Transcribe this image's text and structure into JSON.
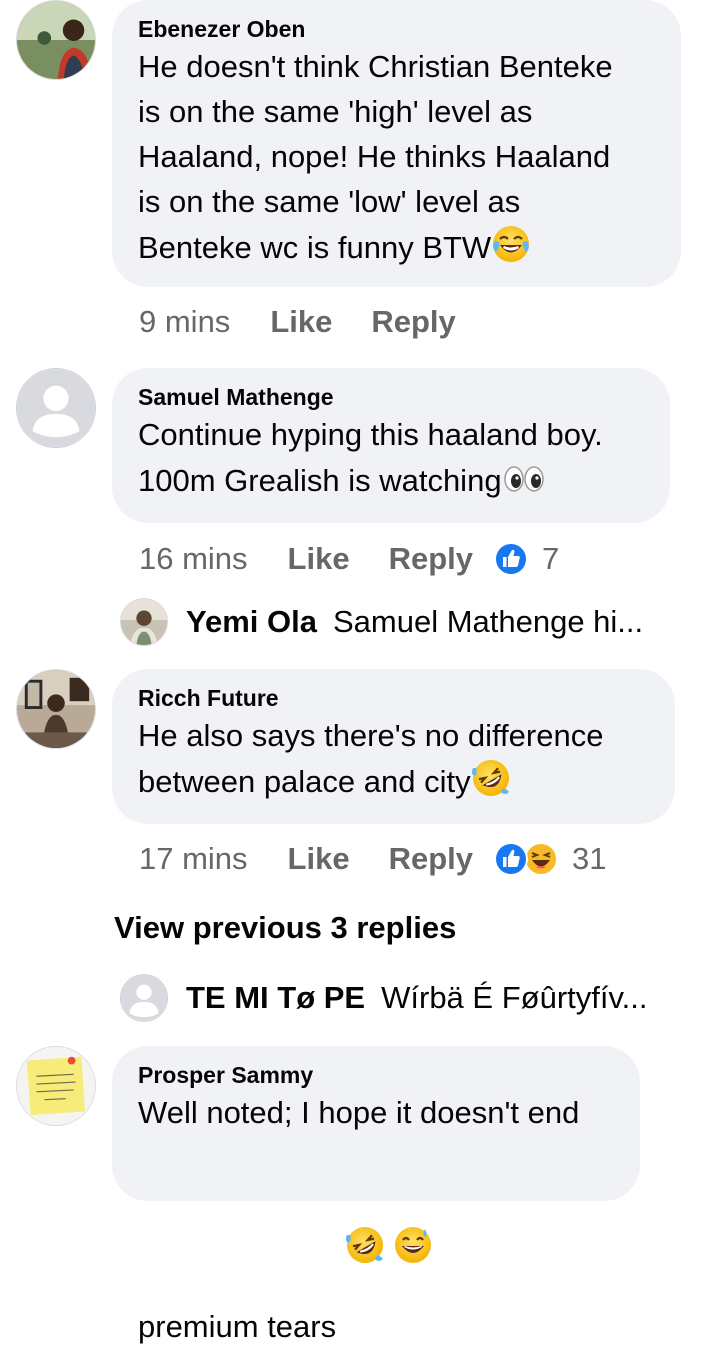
{
  "comments": [
    {
      "author": "Ebenezer Oben",
      "lines": [
        "He doesn't think Christian Benteke",
        "is on the same 'high' level as",
        "Haaland, nope! He thinks Haaland",
        "is on the same 'low' level as"
      ],
      "last_line": "Benteke wc is funny BTW",
      "emoji": "face-with-tears-of-joy-icon",
      "time": "9 mins",
      "like": "Like",
      "reply": "Reply"
    },
    {
      "author": "Samuel Mathenge",
      "lines": [
        "Continue hyping this haaland boy."
      ],
      "last_line": "100m Grealish is watching",
      "emoji": "eyes-icon",
      "time": "16 mins",
      "like": "Like",
      "reply": "Reply",
      "reaction_count": "7",
      "reply_preview": {
        "name": "Yemi Ola",
        "snippet": "Samuel Mathenge hi..."
      }
    },
    {
      "author": "Ricch Future",
      "lines": [
        "He also says there's no difference"
      ],
      "last_line": "between palace and city",
      "emoji": "rolling-on-floor-laughing-icon",
      "time": "17 mins",
      "like": "Like",
      "reply": "Reply",
      "reaction_count": "31",
      "view_previous": "View previous 3 replies",
      "reply_preview": {
        "name": "TE MI Tø PE",
        "snippet": "Wírbä É Føûrtyfív..."
      }
    },
    {
      "author": "Prosper Sammy",
      "lines": [
        "Well noted; I hope it doesn't end"
      ],
      "last_line": "premium tears ",
      "emoji": "rolling-on-floor-laughing-icon",
      "emoji2": "grinning-sweat-icon"
    }
  ],
  "colors": {
    "bubble": "#f0f2f5",
    "meta": "#65676b",
    "like_blue": "#1877f2",
    "haha_yellow": "#f7b928"
  }
}
